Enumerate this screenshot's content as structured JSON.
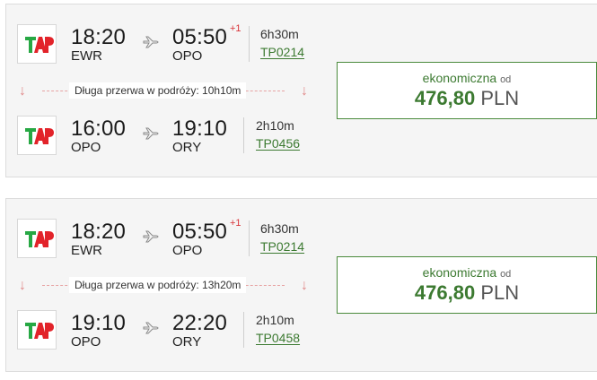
{
  "colors": {
    "accent": "#3c7a31",
    "plus_day": "#d8353a",
    "layover_line": "#e7a3a3"
  },
  "results": [
    {
      "segments": [
        {
          "dep_time": "18:20",
          "dep_code": "EWR",
          "arr_time": "05:50",
          "arr_plus": "+1",
          "arr_code": "OPO",
          "duration": "6h30m",
          "flight": "TP0214",
          "airline_logo": "tap-logo",
          "plane_icon": "plane-icon"
        },
        {
          "dep_time": "16:00",
          "dep_code": "OPO",
          "arr_time": "19:10",
          "arr_plus": "",
          "arr_code": "ORY",
          "duration": "2h10m",
          "flight": "TP0456",
          "airline_logo": "tap-logo",
          "plane_icon": "plane-icon"
        }
      ],
      "layover": "Długa przerwa w podróży: 10h10m",
      "price": {
        "class": "ekonomiczna",
        "from": "od",
        "amount": "476,80",
        "currency": "PLN"
      }
    },
    {
      "segments": [
        {
          "dep_time": "18:20",
          "dep_code": "EWR",
          "arr_time": "05:50",
          "arr_plus": "+1",
          "arr_code": "OPO",
          "duration": "6h30m",
          "flight": "TP0214",
          "airline_logo": "tap-logo",
          "plane_icon": "plane-icon"
        },
        {
          "dep_time": "19:10",
          "dep_code": "OPO",
          "arr_time": "22:20",
          "arr_plus": "",
          "arr_code": "ORY",
          "duration": "2h10m",
          "flight": "TP0458",
          "airline_logo": "tap-logo",
          "plane_icon": "plane-icon"
        }
      ],
      "layover": "Długa przerwa w podróży: 13h20m",
      "price": {
        "class": "ekonomiczna",
        "from": "od",
        "amount": "476,80",
        "currency": "PLN"
      }
    }
  ]
}
